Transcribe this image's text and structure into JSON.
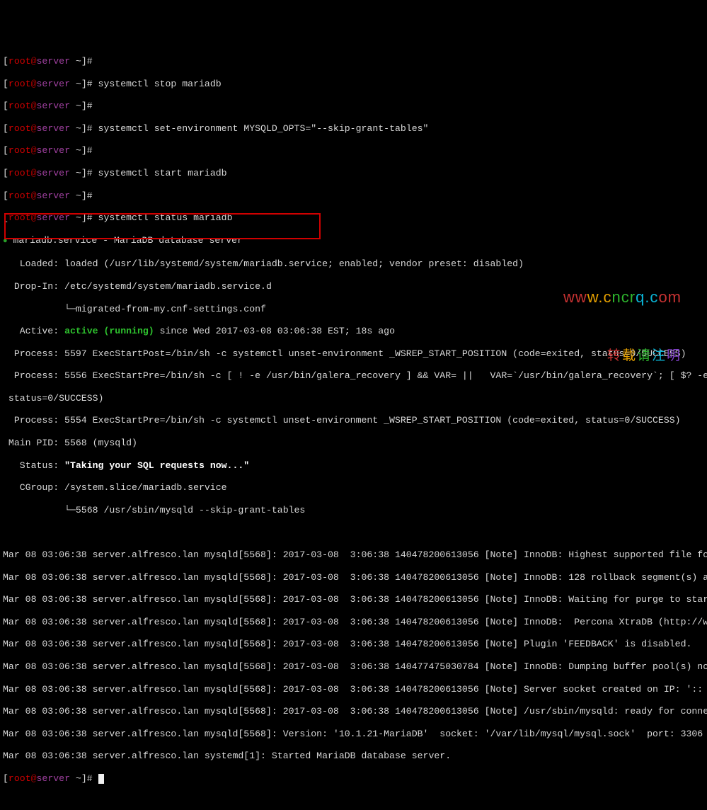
{
  "prompt": {
    "user": "root",
    "at": "@",
    "host": "server",
    "path": " ~",
    "end": "]#"
  },
  "cmds": {
    "stop": " systemctl stop mariadb",
    "setenv": " systemctl set-environment MYSQLD_OPTS=\"--skip-grant-tables\"",
    "start": " systemctl start mariadb",
    "status": " systemctl status mariadb"
  },
  "status": {
    "unit": " mariadb.service - MariaDB database server",
    "loaded": "   Loaded: loaded (/usr/lib/systemd/system/mariadb.service; enabled; vendor preset: disabled)",
    "dropin1": "  Drop-In: /etc/systemd/system/mariadb.service.d",
    "dropin2": "           └─migrated-from-my.cnf-settings.conf",
    "active_lbl": "   Active: ",
    "active_val": "active (running)",
    "active_since": " since Wed 2017-03-08 03:06:38 EST; 18s ago",
    "proc1": "  Process: 5597 ExecStartPost=/bin/sh -c systemctl unset-environment _WSREP_START_POSITION (code=exited, status=0/SUCCESS)",
    "proc2a": "  Process: 5556 ExecStartPre=/bin/sh -c [ ! -e /usr/bin/galera_recovery ] && VAR= ||   VAR=`/usr/bin/galera_recovery`; [ $? -e",
    "proc2b": " status=0/SUCCESS)",
    "proc3": "  Process: 5554 ExecStartPre=/bin/sh -c systemctl unset-environment _WSREP_START_POSITION (code=exited, status=0/SUCCESS)",
    "mainpid": " Main PID: 5568 (mysqld)",
    "status_label": "   Status: ",
    "status_val": "\"Taking your SQL requests now...\"",
    "cgroup1": "   CGroup: /system.slice/mariadb.service",
    "cgroup2": "           └─5568 /usr/sbin/mysqld --skip-grant-tables"
  },
  "logs": {
    "l1": "Mar 08 03:06:38 server.alfresco.lan mysqld[5568]: 2017-03-08  3:06:38 140478200613056 [Note] InnoDB: Highest supported file fo",
    "l2": "Mar 08 03:06:38 server.alfresco.lan mysqld[5568]: 2017-03-08  3:06:38 140478200613056 [Note] InnoDB: 128 rollback segment(s) a",
    "l3": "Mar 08 03:06:38 server.alfresco.lan mysqld[5568]: 2017-03-08  3:06:38 140478200613056 [Note] InnoDB: Waiting for purge to star",
    "l4": "Mar 08 03:06:38 server.alfresco.lan mysqld[5568]: 2017-03-08  3:06:38 140478200613056 [Note] InnoDB:  Percona XtraDB (http://w",
    "l5": "Mar 08 03:06:38 server.alfresco.lan mysqld[5568]: 2017-03-08  3:06:38 140478200613056 [Note] Plugin 'FEEDBACK' is disabled.",
    "l6": "Mar 08 03:06:38 server.alfresco.lan mysqld[5568]: 2017-03-08  3:06:38 140477475030784 [Note] InnoDB: Dumping buffer pool(s) no",
    "l7": "Mar 08 03:06:38 server.alfresco.lan mysqld[5568]: 2017-03-08  3:06:38 140478200613056 [Note] Server socket created on IP: '::",
    "l8": "Mar 08 03:06:38 server.alfresco.lan mysqld[5568]: 2017-03-08  3:06:38 140478200613056 [Note] /usr/sbin/mysqld: ready for conne",
    "l9": "Mar 08 03:06:38 server.alfresco.lan mysqld[5568]: Version: '10.1.21-MariaDB'  socket: '/var/lib/mysql/mysql.sock'  port: 3306",
    "l10": "Mar 08 03:06:38 server.alfresco.lan systemd[1]: Started MariaDB database server."
  },
  "watermark": {
    "url": "www.cncrq.com",
    "txt": "转载请注明"
  }
}
